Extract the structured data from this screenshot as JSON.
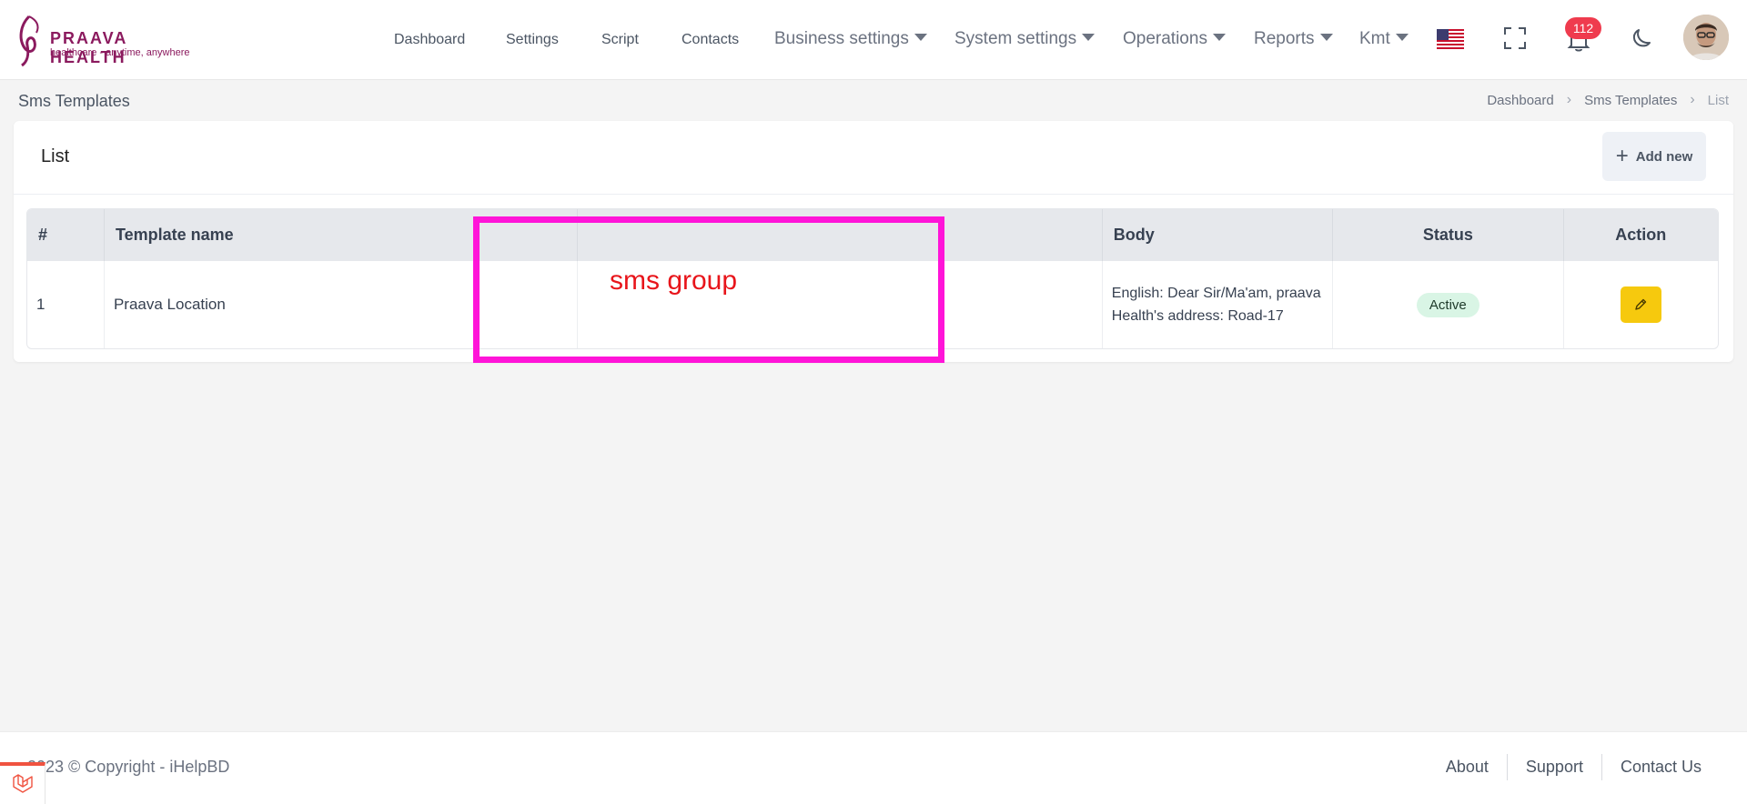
{
  "brand": {
    "name": "PRAAVA HEALTH",
    "tagline": "healthcare - anytime, anywhere",
    "color": "#8b1a5e"
  },
  "nav": {
    "links": [
      "Dashboard",
      "Settings",
      "Script",
      "Contacts"
    ],
    "dropdowns": [
      "Business settings",
      "System settings",
      "Operations",
      "Reports",
      "Kmt"
    ]
  },
  "header_icons": {
    "language": "us-flag-icon",
    "fullscreen": "fullscreen-icon",
    "notifications": "bell-icon",
    "notification_count": "112",
    "theme": "moon-icon",
    "avatar": "user-avatar"
  },
  "page": {
    "title": "Sms Templates",
    "breadcrumb": [
      "Dashboard",
      "Sms Templates",
      "List"
    ]
  },
  "card": {
    "title": "List",
    "add_button": "Add new"
  },
  "table": {
    "headers": [
      "#",
      "Template name",
      "",
      "Body",
      "Status",
      "Action"
    ],
    "rows": [
      {
        "index": "1",
        "name": "Praava Location",
        "group": "",
        "body": "English: Dear Sir/Ma'am, praava Health's address: Road-17",
        "status": "Active"
      }
    ]
  },
  "annotation": {
    "label": "sms group",
    "box_color": "#ff14d8",
    "text_color": "#e8151b"
  },
  "footer": {
    "copyright": "2023 © Copyright - iHelpBD",
    "links": [
      "About",
      "Support",
      "Contact Us"
    ]
  },
  "colors": {
    "status_active_bg": "#d9f5e5",
    "edit_button": "#f6c90e",
    "badge": "#ef3b4e"
  }
}
